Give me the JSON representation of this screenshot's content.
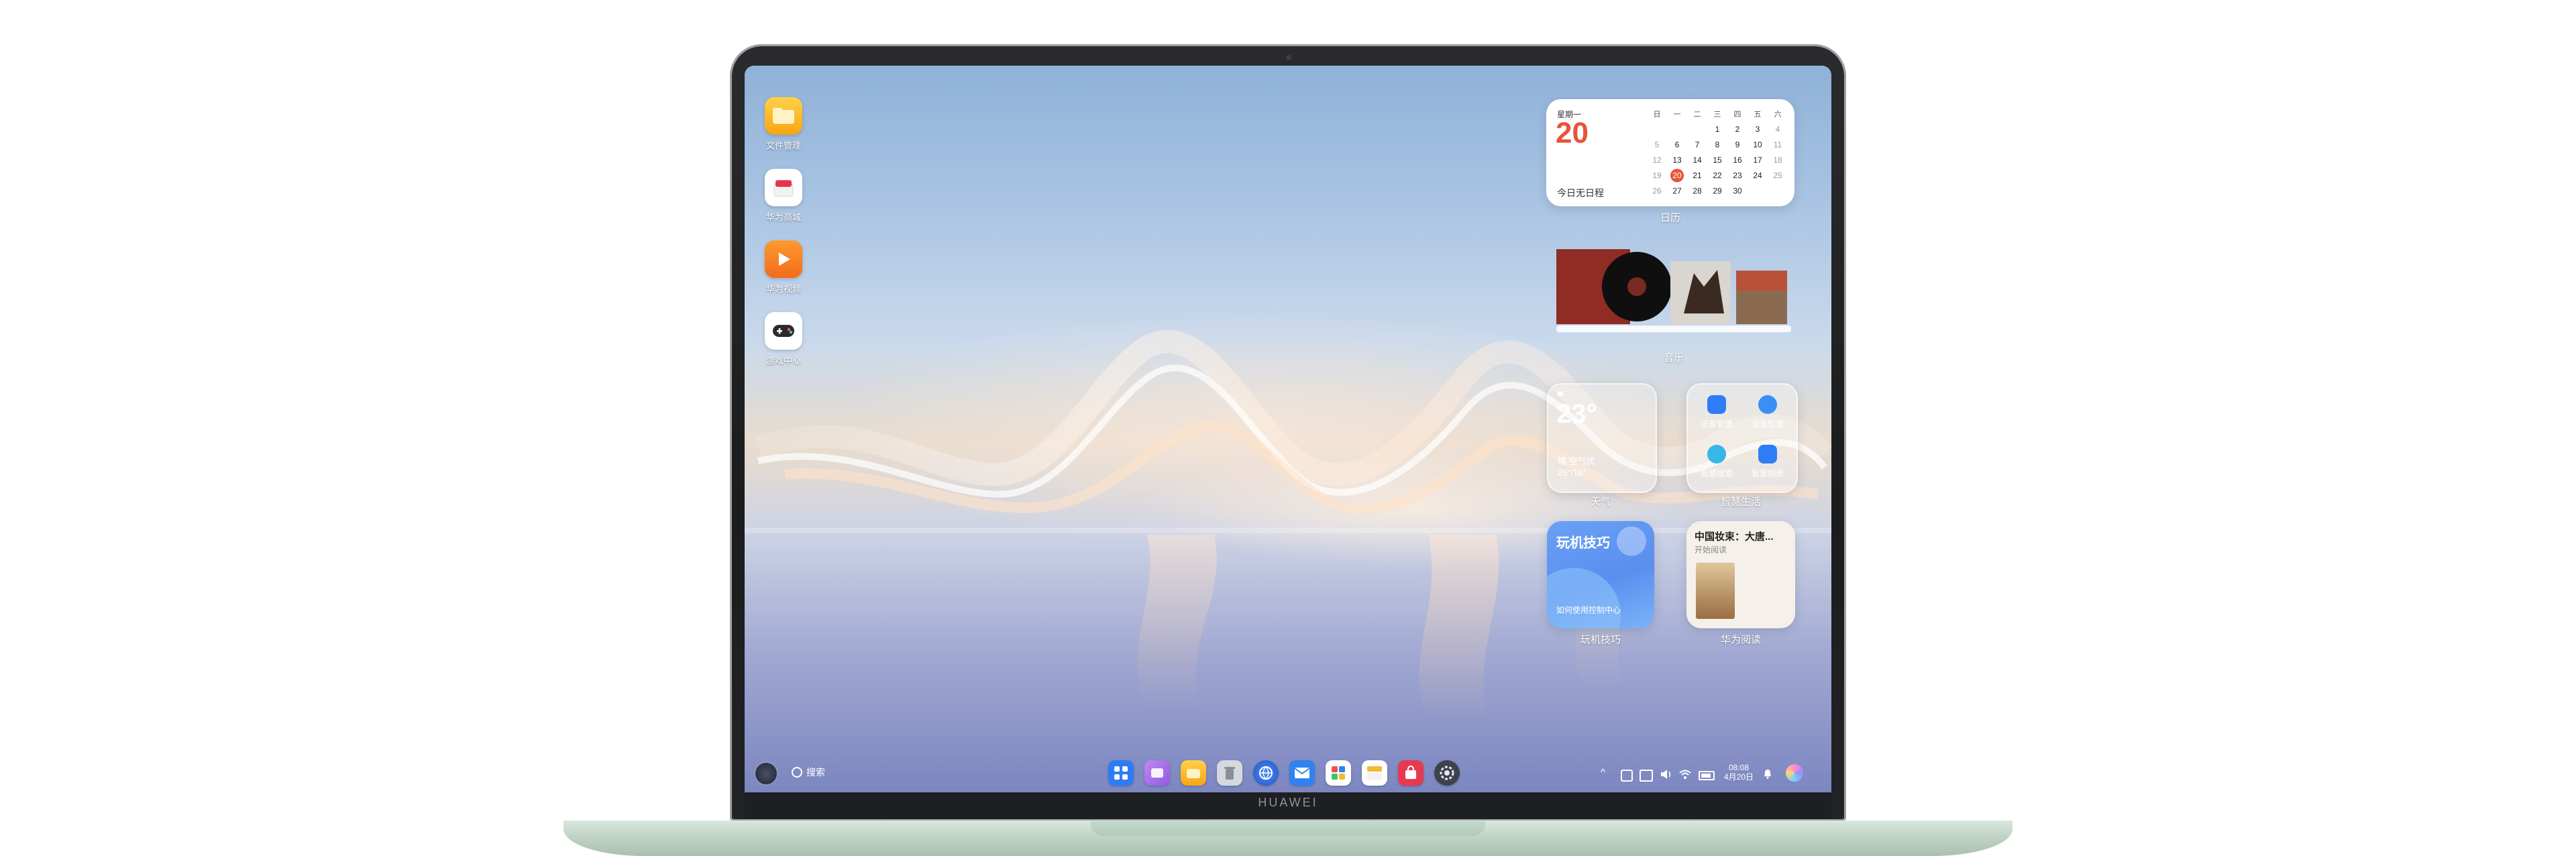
{
  "device": {
    "brand": "HUAWEI"
  },
  "desktop_icons": [
    {
      "name": "file-manager",
      "label": "文件管理",
      "icon": "folder-icon",
      "color": "#f8b81a"
    },
    {
      "name": "huawei-store",
      "label": "华为商城",
      "icon": "shop-icon",
      "color": "#ffffff"
    },
    {
      "name": "huawei-video",
      "label": "华为视频",
      "icon": "play-icon",
      "color": "#f57c1f"
    },
    {
      "name": "game-center",
      "label": "游戏中心",
      "icon": "gamepad-icon",
      "color": "#ffffff"
    }
  ],
  "calendar": {
    "weekday": "星期一",
    "day": "20",
    "note": "今日无日程",
    "label": "日历",
    "accent": "#e8543a",
    "headers": [
      "日",
      "一",
      "二",
      "三",
      "四",
      "五",
      "六"
    ],
    "weeks": [
      [
        "",
        "",
        "",
        "1",
        "2",
        "3",
        "4"
      ],
      [
        "5",
        "6",
        "7",
        "8",
        "9",
        "10",
        "11"
      ],
      [
        "12",
        "13",
        "14",
        "15",
        "16",
        "17",
        "18"
      ],
      [
        "19",
        "20",
        "21",
        "22",
        "23",
        "24",
        "25"
      ],
      [
        "26",
        "27",
        "28",
        "29",
        "30",
        "",
        ""
      ]
    ]
  },
  "music": {
    "label": "音乐"
  },
  "weather": {
    "temp": "23°",
    "desc": "晴 空气优",
    "range": "26°/16°",
    "label": "天气"
  },
  "smart_life": {
    "label": "智慧生活",
    "items": [
      "设备管理",
      "设备位置",
      "智慧搜索",
      "智慧相册"
    ]
  },
  "tips": {
    "title": "玩机技巧",
    "subtitle": "如何使用控制中心",
    "label": "玩机技巧"
  },
  "reader": {
    "title": "中国妆束：大唐...",
    "subtitle": "开始阅读",
    "label": "华为阅读"
  },
  "taskbar": {
    "search_label": "搜索",
    "dock": [
      {
        "name": "app-grid",
        "icon": "grid-icon",
        "color": "#2d7cf6"
      },
      {
        "name": "gallery",
        "icon": "gallery-icon",
        "color": "#b377e8"
      },
      {
        "name": "files",
        "icon": "folder-icon",
        "color": "#f8b81a"
      },
      {
        "name": "recycle-bin",
        "icon": "trash-icon",
        "color": "#c8ccd2"
      },
      {
        "name": "browser",
        "icon": "browser-icon",
        "color": "#2f6fe5"
      },
      {
        "name": "mail",
        "icon": "mail-icon",
        "color": "#2f82f2"
      },
      {
        "name": "app-store",
        "icon": "appstore-icon",
        "color": "#ffffff"
      },
      {
        "name": "notes",
        "icon": "notes-icon",
        "color": "#f6b733"
      },
      {
        "name": "mall",
        "icon": "bag-icon",
        "color": "#e83a4f"
      },
      {
        "name": "settings",
        "icon": "settings-icon",
        "color": "#5a5f69"
      }
    ],
    "time": "08:08",
    "date": "4月20日"
  }
}
